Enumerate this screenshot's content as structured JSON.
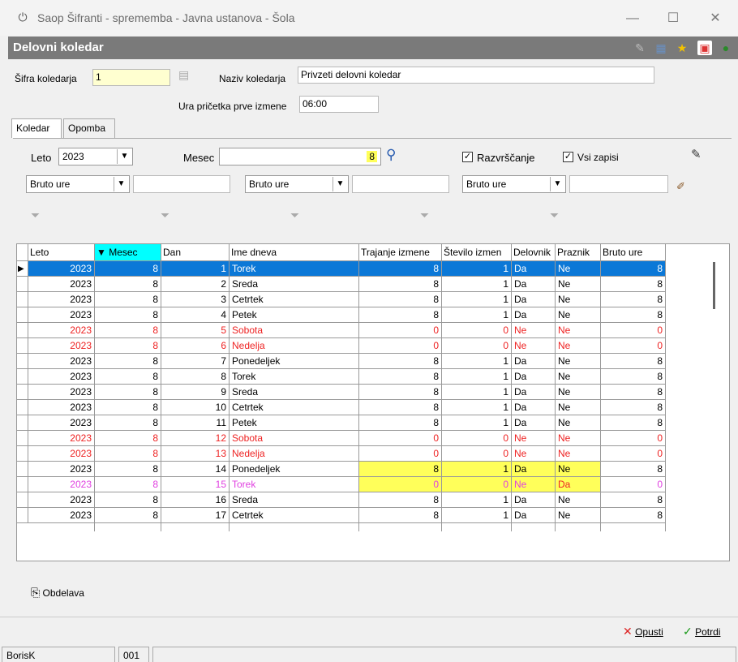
{
  "window": {
    "title": "Saop  Šifranti - sprememba - Javna ustanova - Šola",
    "minimize_glyph": "—",
    "maximize_glyph": "☐",
    "close_glyph": "✕"
  },
  "header": {
    "title": "Delovni koledar",
    "icons": [
      "edit-icon",
      "grid-icon",
      "star-icon",
      "pdf-icon",
      "exit-icon"
    ]
  },
  "form": {
    "sifra_label": "Šifra koledarja",
    "sifra_value": "1",
    "naziv_label": "Naziv koledarja",
    "naziv_value": "Privzeti delovni koledar",
    "ura_label": "Ura pričetka prve izmene",
    "ura_value": "06:00"
  },
  "tabs": [
    {
      "label": "Koledar",
      "active": true
    },
    {
      "label": "Opomba",
      "active": false
    }
  ],
  "filters": {
    "leto_label": "Leto",
    "leto_value": "2023",
    "mesec_label": "Mesec",
    "mesec_value": "8",
    "razvrscanje_label": "Razvrščanje",
    "razvrscanje_checked": true,
    "vsi_zapisi_label": "Vsi zapisi",
    "vsi_zapisi_checked": true,
    "bruto_1": "Bruto ure",
    "bruto_2": "Bruto ure",
    "bruto_3": "Bruto ure",
    "checkmark": "✓"
  },
  "grid": {
    "columns": [
      "Leto",
      "▼ Mesec",
      "Dan",
      "Ime dneva",
      "Trajanje izmene",
      "Število izmen",
      "Delovnik",
      "Praznik",
      "Bruto ure"
    ],
    "rows": [
      [
        "2023",
        "8",
        "1",
        "Torek",
        "8",
        "1",
        "Da",
        "Ne",
        "8"
      ],
      [
        "2023",
        "8",
        "2",
        "Sreda",
        "8",
        "1",
        "Da",
        "Ne",
        "8"
      ],
      [
        "2023",
        "8",
        "3",
        "Cetrtek",
        "8",
        "1",
        "Da",
        "Ne",
        "8"
      ],
      [
        "2023",
        "8",
        "4",
        "Petek",
        "8",
        "1",
        "Da",
        "Ne",
        "8"
      ],
      [
        "2023",
        "8",
        "5",
        "Sobota",
        "0",
        "0",
        "Ne",
        "Ne",
        "0"
      ],
      [
        "2023",
        "8",
        "6",
        "Nedelja",
        "0",
        "0",
        "Ne",
        "Ne",
        "0"
      ],
      [
        "2023",
        "8",
        "7",
        "Ponedeljek",
        "8",
        "1",
        "Da",
        "Ne",
        "8"
      ],
      [
        "2023",
        "8",
        "8",
        "Torek",
        "8",
        "1",
        "Da",
        "Ne",
        "8"
      ],
      [
        "2023",
        "8",
        "9",
        "Sreda",
        "8",
        "1",
        "Da",
        "Ne",
        "8"
      ],
      [
        "2023",
        "8",
        "10",
        "Cetrtek",
        "8",
        "1",
        "Da",
        "Ne",
        "8"
      ],
      [
        "2023",
        "8",
        "11",
        "Petek",
        "8",
        "1",
        "Da",
        "Ne",
        "8"
      ],
      [
        "2023",
        "8",
        "12",
        "Sobota",
        "0",
        "0",
        "Ne",
        "Ne",
        "0"
      ],
      [
        "2023",
        "8",
        "13",
        "Nedelja",
        "0",
        "0",
        "Ne",
        "Ne",
        "0"
      ],
      [
        "2023",
        "8",
        "14",
        "Ponedeljek",
        "8",
        "1",
        "Da",
        "Ne",
        "8"
      ],
      [
        "2023",
        "8",
        "15",
        "Torek",
        "0",
        "0",
        "Ne",
        "Da",
        "0"
      ],
      [
        "2023",
        "8",
        "16",
        "Sreda",
        "8",
        "1",
        "Da",
        "Ne",
        "8"
      ],
      [
        "2023",
        "8",
        "17",
        "Cetrtek",
        "8",
        "1",
        "Da",
        "Ne",
        "8"
      ]
    ],
    "row_styles": [
      "sel",
      "",
      "",
      "",
      "red",
      "red",
      "",
      "",
      "",
      "",
      "",
      "red",
      "red",
      "",
      "magenta",
      "",
      ""
    ],
    "status_colors": {
      "selected": "#0b78d7",
      "weekend": "#ee2222",
      "holiday": "#e040e0",
      "highlight": "#ffff5a",
      "sort_header": "#00ffff"
    }
  },
  "bottom": {
    "obdelava_label": "Obdelava",
    "opusti_label": "Opusti",
    "potrdi_label": "Potrdi",
    "cross_glyph": "✕",
    "check_glyph": "✓"
  },
  "status": {
    "user": "BorisK",
    "code": "001"
  }
}
